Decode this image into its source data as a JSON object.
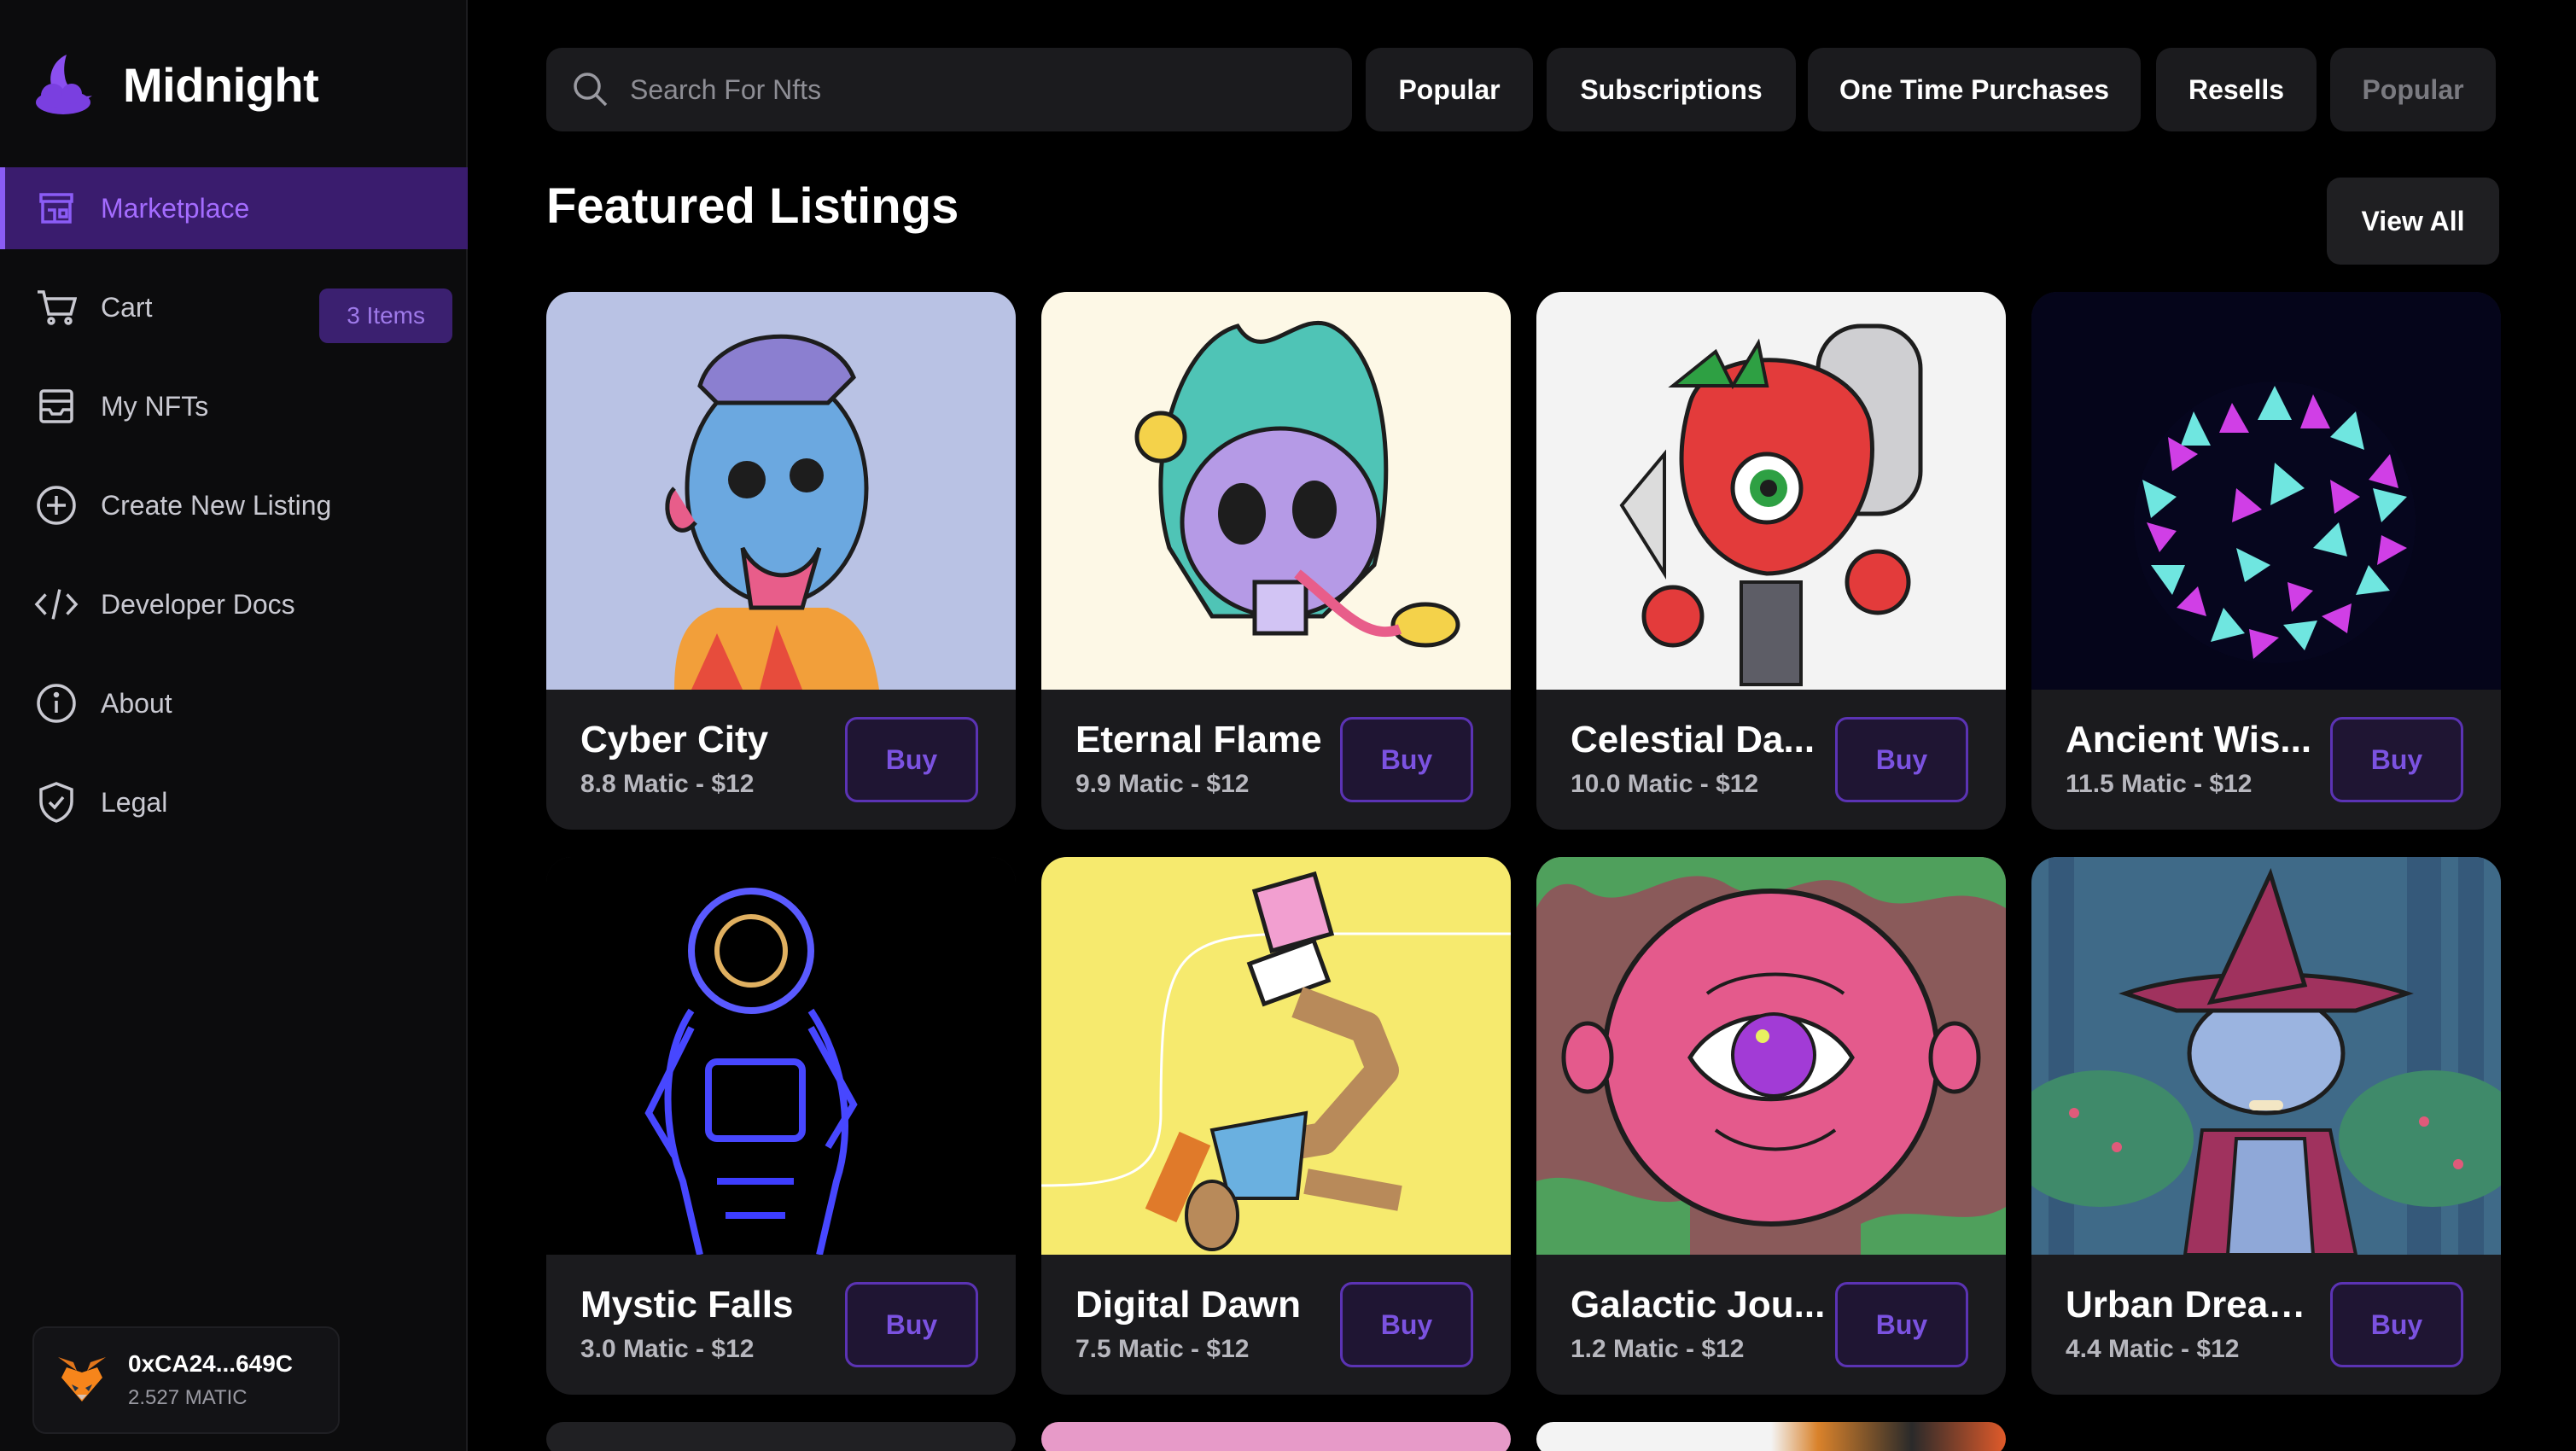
{
  "app": {
    "title": "Midnight"
  },
  "sidebar": {
    "items": [
      {
        "label": "Marketplace",
        "icon": "storefront-icon",
        "active": true
      },
      {
        "label": "Cart",
        "icon": "cart-icon",
        "badge": "3 Items"
      },
      {
        "label": "My NFTs",
        "icon": "inbox-icon"
      },
      {
        "label": "Create New Listing",
        "icon": "plus-circle-icon"
      },
      {
        "label": "Developer Docs",
        "icon": "code-icon"
      },
      {
        "label": "About",
        "icon": "info-icon"
      },
      {
        "label": "Legal",
        "icon": "shield-check-icon"
      }
    ],
    "wallet": {
      "address": "0xCA24...649C",
      "balance": "2.527 MATIC",
      "icon": "metamask-fox-icon"
    }
  },
  "search": {
    "placeholder": "Search For Nfts"
  },
  "filters": [
    "Popular",
    "Subscriptions",
    "One Time Purchases",
    "Resells",
    "Popular"
  ],
  "main": {
    "title": "Featured Listings",
    "view_all": "View All"
  },
  "listings": [
    {
      "name": "Cyber City",
      "price": "8.8 Matic - $12",
      "buy": "Buy"
    },
    {
      "name": "Eternal Flame",
      "price": "9.9 Matic - $12",
      "buy": "Buy"
    },
    {
      "name": "Celestial Da...",
      "price": "10.0 Matic - $12",
      "buy": "Buy"
    },
    {
      "name": "Ancient Wis...",
      "price": "11.5 Matic - $12",
      "buy": "Buy"
    },
    {
      "name": "Mystic Falls",
      "price": "3.0 Matic - $12",
      "buy": "Buy"
    },
    {
      "name": "Digital Dawn",
      "price": "7.5 Matic - $12",
      "buy": "Buy"
    },
    {
      "name": "Galactic Jou...",
      "price": "1.2 Matic - $12",
      "buy": "Buy"
    },
    {
      "name": "Urban Dreams",
      "price": "4.4 Matic - $12",
      "buy": "Buy"
    }
  ],
  "colors": {
    "accent": "#8b5cf6",
    "active_bg": "#3a1c6e",
    "card_bg": "#1b1b1e"
  }
}
